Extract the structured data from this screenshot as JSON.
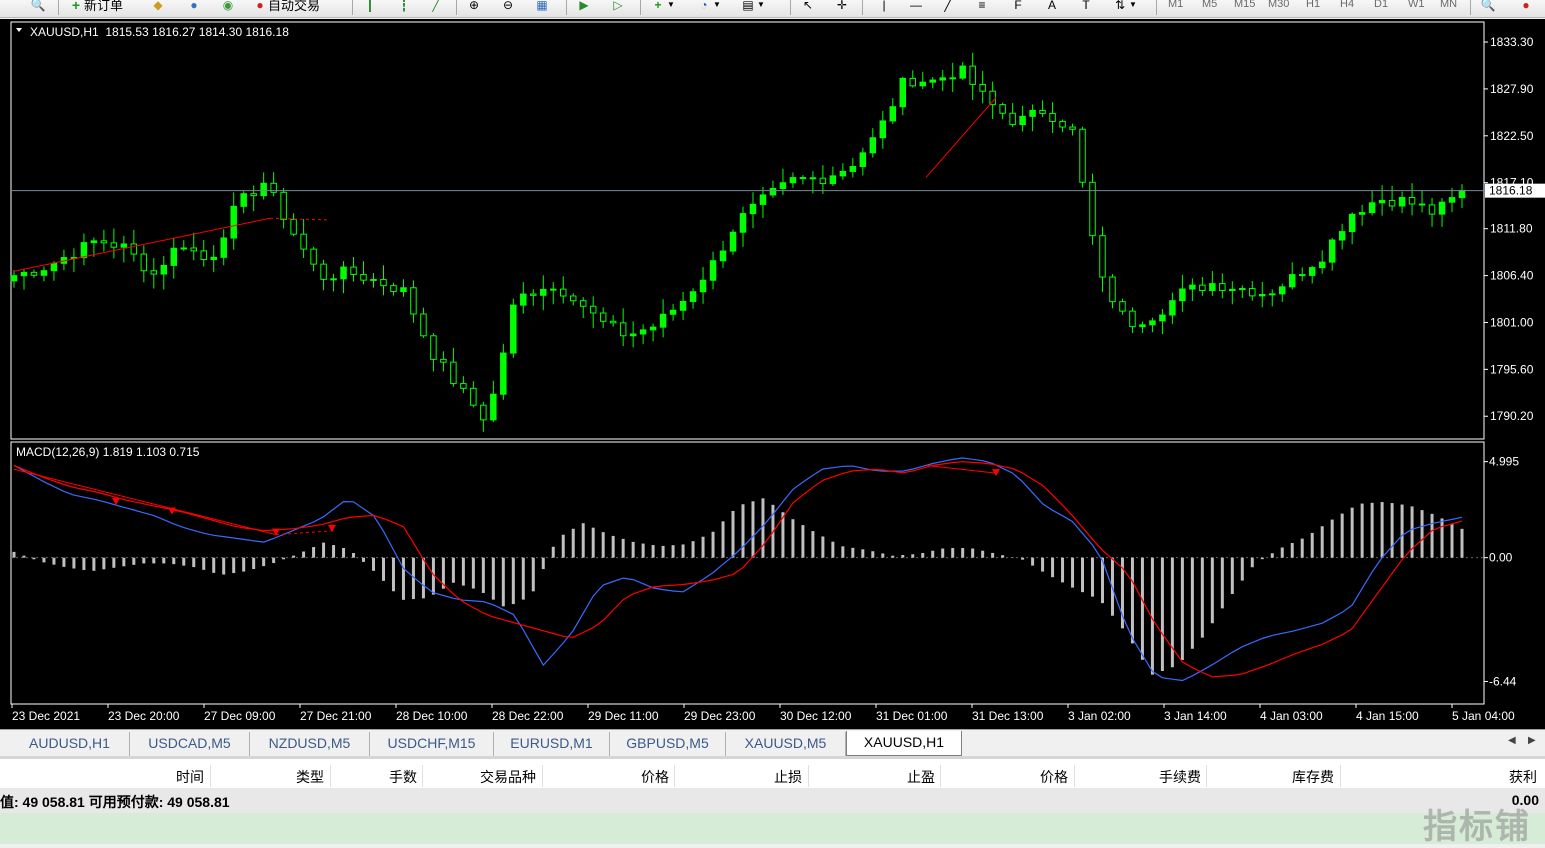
{
  "toolbar": {
    "new_order_label": "新订单",
    "autotrade_label": "自动交易",
    "timeframes": [
      "M1",
      "M5",
      "M15",
      "M30",
      "H1",
      "H4",
      "D1",
      "W1",
      "MN"
    ],
    "tools": [
      "cursor",
      "crosshair",
      "vertical-line",
      "horizontal-line",
      "trendline",
      "fibonacci",
      "text",
      "label"
    ],
    "text_tool_label": "A"
  },
  "chart": {
    "info_line": "XAUUSD,H1  1815.53 1816.27 1814.30 1816.18",
    "current_price_label": "1816.18",
    "colors": {
      "background": "#000000",
      "bull": "#00ff00",
      "bear": "#000000",
      "wick": "#00ff00",
      "bid_line": "#7a8a9a",
      "trendline": "#ff0000",
      "macd_line": "#3a6aff",
      "signal_line": "#ff0000",
      "histogram": "#c0c0c0",
      "axis_text": "#ffffff"
    }
  },
  "macd": {
    "info_line": "MACD(12,26,9) 1.819 1.103 0.715"
  },
  "chart_data": [
    {
      "type": "candlestick",
      "title": "XAUUSD,H1",
      "x": [
        "23 Dec 2021",
        "23 Dec 20:00",
        "27 Dec 09:00",
        "27 Dec 21:00",
        "28 Dec 10:00",
        "28 Dec 22:00",
        "29 Dec 11:00",
        "29 Dec 23:00",
        "30 Dec 12:00",
        "31 Dec 01:00",
        "31 Dec 13:00",
        "3 Jan 02:00",
        "3 Jan 14:00",
        "4 Jan 03:00",
        "4 Jan 15:00",
        "5 Jan 04:00"
      ],
      "ytick_labels": [
        "1833.30",
        "1827.90",
        "1822.50",
        "1817.10",
        "1811.80",
        "1806.40",
        "1801.00",
        "1795.60",
        "1790.20"
      ],
      "ylim": [
        1788.5,
        1834.8
      ],
      "last_price": 1816.18,
      "close_path": [
        1806.4,
        1807.2,
        1808.8,
        1810.5,
        1809.6,
        1806.5,
        1810.3,
        1807.8,
        1814.5,
        1817.2,
        1811.5,
        1806.2,
        1806.8,
        1805.8,
        1804.6,
        1797.6,
        1793.4,
        1789.6,
        1803.6,
        1805.2,
        1804.4,
        1801.2,
        1799.5,
        1800.6,
        1803.4,
        1807.2,
        1812.7,
        1815.3,
        1817.4,
        1817.6,
        1818.9,
        1822.6,
        1829.0,
        1828.8,
        1830.1,
        1826.3,
        1824.0,
        1825.5,
        1823.2,
        1806.2,
        1800.8,
        1801.9,
        1804.5,
        1805.5,
        1805.0,
        1804.3,
        1806.3,
        1808.7,
        1813.5,
        1815.2,
        1815.0,
        1813.6,
        1815.9
      ]
    },
    {
      "type": "line",
      "title": "MACD(12,26,9)",
      "values_label": "1.819 1.103 0.715",
      "ytick_labels": [
        "4.995",
        "0.00",
        "-6.44"
      ],
      "ylim": [
        -7.3,
        5.6
      ],
      "macd_path": [
        4.8,
        4.0,
        3.3,
        3.0,
        2.6,
        2.2,
        1.6,
        1.2,
        1.0,
        0.8,
        1.4,
        2.0,
        3.1,
        2.1,
        -0.6,
        -1.8,
        -2.2,
        -2.3,
        -3.0,
        -5.6,
        -4.0,
        -1.5,
        -1.0,
        -1.6,
        -1.8,
        -0.9,
        0.3,
        1.8,
        3.6,
        4.6,
        4.8,
        4.5,
        4.5,
        4.9,
        5.2,
        5.0,
        4.3,
        2.7,
        1.9,
        0.2,
        -3.8,
        -6.2,
        -6.4,
        -5.6,
        -4.7,
        -4.1,
        -3.8,
        -3.4,
        -2.6,
        -0.2,
        1.4,
        1.8,
        2.1
      ],
      "signal_path": [
        4.8,
        4.2,
        3.7,
        3.4,
        3.0,
        2.7,
        2.4,
        2.0,
        1.6,
        1.4,
        1.5,
        1.7,
        2.1,
        2.2,
        1.6,
        -0.8,
        -2.2,
        -3.0,
        -3.4,
        -3.8,
        -4.2,
        -3.5,
        -2.0,
        -1.5,
        -1.4,
        -1.2,
        -0.8,
        0.8,
        2.9,
        4.0,
        4.5,
        4.6,
        4.4,
        4.8,
        5.0,
        4.9,
        4.6,
        3.7,
        2.2,
        0.5,
        -0.8,
        -3.5,
        -5.5,
        -6.2,
        -6.1,
        -5.6,
        -5.0,
        -4.5,
        -3.8,
        -1.8,
        0.2,
        1.5,
        1.9
      ],
      "histogram_path": [
        0.3,
        -0.2,
        -0.5,
        -0.7,
        -0.5,
        -0.3,
        -0.3,
        -0.5,
        -0.9,
        -0.7,
        -0.3,
        0.2,
        0.8,
        0.4,
        -0.8,
        -2.2,
        -2.1,
        -1.3,
        -1.7,
        -2.6,
        -2.0,
        1.0,
        1.8,
        1.2,
        0.8,
        0.6,
        0.7,
        1.3,
        2.7,
        3.1,
        2.1,
        1.3,
        0.6,
        0.4,
        0.1,
        0.2,
        0.5,
        0.5,
        0.2,
        -0.1,
        -0.9,
        -1.6,
        -2.2,
        -3.9,
        -6.1,
        -5.6,
        -4.1,
        -2.1,
        -0.3,
        0.5,
        1.1,
        2.0,
        2.8,
        2.9,
        2.7,
        2.2,
        1.5
      ]
    }
  ],
  "symbol_tabs": [
    "AUDUSD,H1",
    "USDCAD,M5",
    "NZDUSD,M5",
    "USDCHF,M15",
    "EURUSD,M1",
    "GBPUSD,M5",
    "XAUUSD,M5",
    "XAUUSD,H1"
  ],
  "active_tab": "XAUUSD,H1",
  "terminal": {
    "columns": [
      "时间",
      "类型",
      "手数",
      "交易品种",
      "价格",
      "止损",
      "止盈",
      "价格",
      "手续费",
      "库存费",
      "获利"
    ],
    "balance_text": "值: 49 058.81  可用预付款: 49 058.81",
    "profit_total": "0.00"
  },
  "watermark": "指标铺"
}
